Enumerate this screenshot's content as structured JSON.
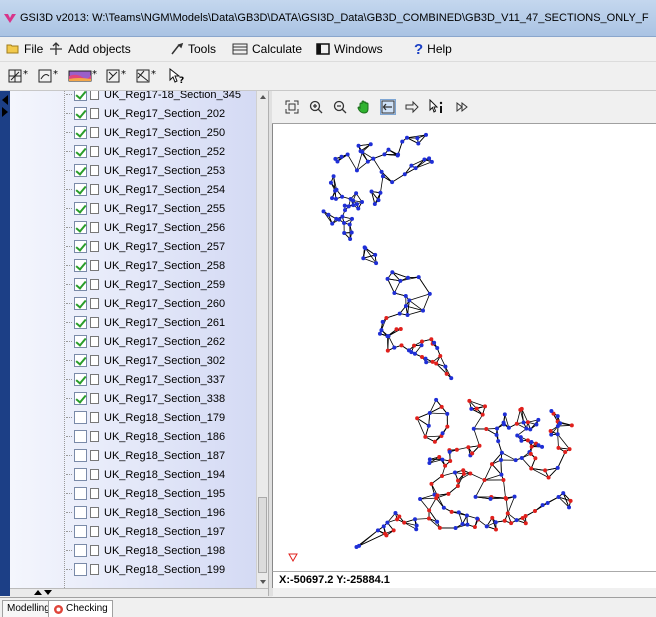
{
  "window": {
    "title": "GSI3D v2013: W:\\Teams\\NGM\\Models\\Data\\GB3D\\DATA\\GSI3D_Data\\GB3D_COMBINED\\GB3D_V11_47_SECTIONS_ONLY_F"
  },
  "menu": {
    "file": "File",
    "add_objects": "Add objects",
    "tools": "Tools",
    "calculate": "Calculate",
    "windows": "Windows",
    "help": "Help"
  },
  "tree": {
    "items": [
      {
        "label": "UK_Reg17-18_Section_345",
        "checked": true
      },
      {
        "label": "UK_Reg17_Section_202",
        "checked": true
      },
      {
        "label": "UK_Reg17_Section_250",
        "checked": true
      },
      {
        "label": "UK_Reg17_Section_252",
        "checked": true
      },
      {
        "label": "UK_Reg17_Section_253",
        "checked": true
      },
      {
        "label": "UK_Reg17_Section_254",
        "checked": true
      },
      {
        "label": "UK_Reg17_Section_255",
        "checked": true
      },
      {
        "label": "UK_Reg17_Section_256",
        "checked": true
      },
      {
        "label": "UK_Reg17_Section_257",
        "checked": true
      },
      {
        "label": "UK_Reg17_Section_258",
        "checked": true
      },
      {
        "label": "UK_Reg17_Section_259",
        "checked": true
      },
      {
        "label": "UK_Reg17_Section_260",
        "checked": true
      },
      {
        "label": "UK_Reg17_Section_261",
        "checked": true
      },
      {
        "label": "UK_Reg17_Section_262",
        "checked": true
      },
      {
        "label": "UK_Reg17_Section_302",
        "checked": true
      },
      {
        "label": "UK_Reg17_Section_337",
        "checked": true
      },
      {
        "label": "UK_Reg17_Section_338",
        "checked": true
      },
      {
        "label": "UK_Reg18_Section_179",
        "checked": false
      },
      {
        "label": "UK_Reg18_Section_186",
        "checked": false
      },
      {
        "label": "UK_Reg18_Section_187",
        "checked": false
      },
      {
        "label": "UK_Reg18_Section_194",
        "checked": false
      },
      {
        "label": "UK_Reg18_Section_195",
        "checked": false
      },
      {
        "label": "UK_Reg18_Section_196",
        "checked": false
      },
      {
        "label": "UK_Reg18_Section_197",
        "checked": false
      },
      {
        "label": "UK_Reg18_Section_198",
        "checked": false
      },
      {
        "label": "UK_Reg18_Section_199",
        "checked": false
      }
    ]
  },
  "map": {
    "coordinates": "X:-50697.2 Y:-25884.1",
    "colors": {
      "node": "#1f2fd6",
      "selected_node": "#e0201c",
      "line": "#000000"
    }
  },
  "tabs": {
    "modelling": "Modelling",
    "checking": "Checking"
  }
}
